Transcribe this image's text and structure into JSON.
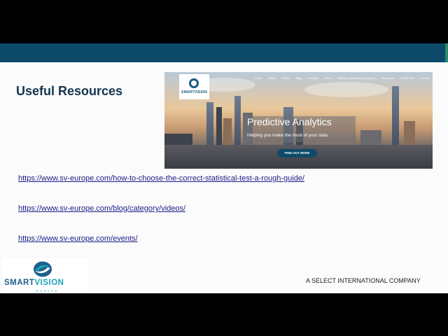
{
  "slide": {
    "title": "Useful Resources",
    "links": [
      "https://www.sv-europe.com/how-to-choose-the-correct-statistical-test-a-rough-guide/",
      "https://www.sv-europe.com/blog/category/videos/",
      "https://www.sv-europe.com/events/"
    ],
    "company_tagline": "A SELECT INTERNATIONAL COMPANY"
  },
  "website_screenshot": {
    "logo_text": "SMARTVISION",
    "nav": [
      "Home",
      "About",
      "Events",
      "Blog",
      "Products",
      "Store",
      "Training, consultancy & support",
      "Resources",
      "CRISP-DM",
      "Contact"
    ],
    "hero_title": "Predictive Analytics",
    "hero_subtitle": "Helping you make the most of your data",
    "cta": "FIND OUT MORE"
  },
  "logo": {
    "brand_part1": "SMART",
    "brand_part2": "VISION",
    "region": "EUROPE"
  },
  "colors": {
    "header_bar": "#0d4a6a",
    "title": "#14344e",
    "link": "#1c1c8a",
    "brand_dark": "#1f5f8b",
    "brand_light": "#1aa3b8"
  }
}
